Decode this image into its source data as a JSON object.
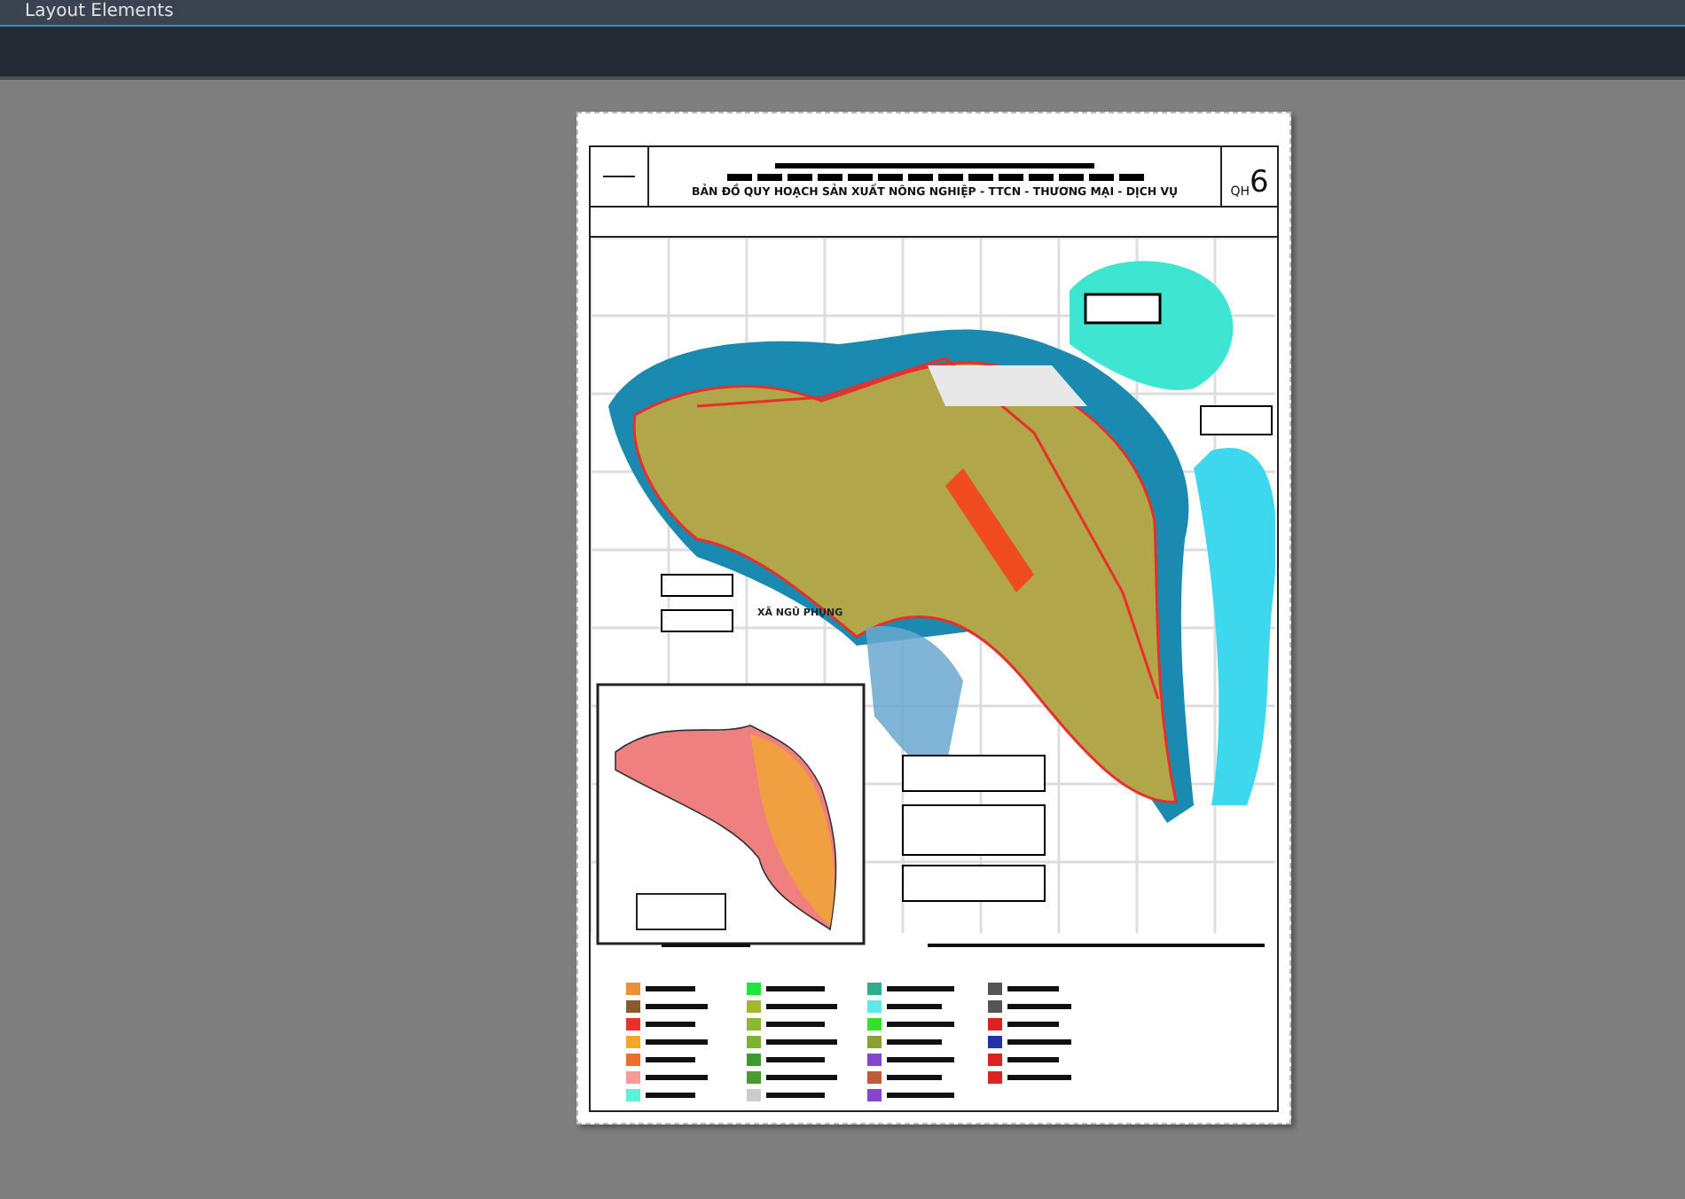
{
  "window": {
    "title": "Layout Elements"
  },
  "sheet": {
    "title": "BẢN ĐỒ QUY HOẠCH SẢN XUẤT NÔNG NGHIỆP - TTCN - THƯƠNG MẠI - DỊCH VỤ",
    "code_prefix": "QH",
    "code_number": "6",
    "map_label": "XÃ NGŨ PHỤNG"
  }
}
